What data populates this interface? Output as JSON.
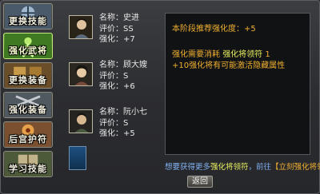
{
  "tabs": [
    {
      "label": "更换技能",
      "icon": "swap-skill-icon",
      "active": false
    },
    {
      "label": "强化武将",
      "icon": "strengthen-general-icon",
      "active": true
    },
    {
      "label": "更换装备",
      "icon": "swap-equipment-icon",
      "active": false
    },
    {
      "label": "强化装备",
      "icon": "strengthen-equipment-icon",
      "active": false
    },
    {
      "label": "后宫护符",
      "icon": "harem-amulet-icon",
      "active": false
    },
    {
      "label": "学习技能",
      "icon": "learn-skill-icon",
      "active": false
    }
  ],
  "characters": [
    {
      "name_label": "名称：",
      "name": "史进",
      "rating_label": "评价：",
      "rating": "SS",
      "level_label": "强化：",
      "level": "+7"
    },
    {
      "name_label": "名称：",
      "name": "顾大嫂",
      "rating_label": "评价：",
      "rating": "S",
      "level_label": "强化：",
      "level": "+6"
    },
    {
      "name_label": "名称：",
      "name": "阮小七",
      "rating_label": "评价：",
      "rating": "S",
      "level_label": "强化：",
      "level": "+5"
    }
  ],
  "panel": {
    "recommend_text": "本阶段推荐强化度：+5",
    "consume_prefix": "强化需要消耗 ",
    "consume_item": "强化将领符",
    "consume_suffix": " 1",
    "chance_text": "+10强化将有可能激活隐藏属性"
  },
  "prompt": {
    "prefix": "想要获得更多",
    "item": "强化将领符",
    "middle": "，前往",
    "link": "【立刻强化将领】"
  },
  "back_label": "返回",
  "colors": {
    "accent": "#f0b030",
    "highlight": "#e8f060",
    "link_blue": "#7fb0f0",
    "active_tab": "#5f9a38"
  }
}
